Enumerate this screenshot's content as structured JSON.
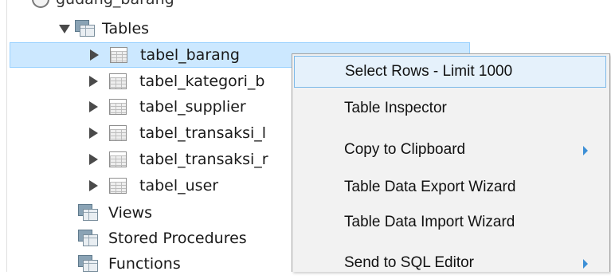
{
  "tree": {
    "schema_label": "gudang_barang",
    "tables_label": "Tables",
    "tables": [
      {
        "label": "tabel_barang",
        "selected": true
      },
      {
        "label": "tabel_kategori_b"
      },
      {
        "label": "tabel_supplier"
      },
      {
        "label": "tabel_transaksi_l"
      },
      {
        "label": "tabel_transaksi_r"
      },
      {
        "label": "tabel_user"
      }
    ],
    "views_label": "Views",
    "stored_procedures_label": "Stored Procedures",
    "functions_label": "Functions"
  },
  "context_menu": {
    "items": [
      {
        "label": "Select Rows - Limit 1000",
        "highlighted": true,
        "submenu": false
      },
      {
        "label": "Table Inspector",
        "submenu": false
      },
      {
        "label": "Copy to Clipboard",
        "submenu": true
      },
      {
        "label": "Table Data Export Wizard",
        "submenu": false
      },
      {
        "label": "Table Data Import Wizard",
        "submenu": false
      },
      {
        "label": "Send to SQL Editor",
        "submenu": true
      }
    ]
  },
  "colors": {
    "selection_bg": "#cce8ff",
    "menu_highlight_bg": "#e5f1fb",
    "menu_highlight_border": "#7cb9e8",
    "submenu_arrow": "#3d8fd6"
  }
}
